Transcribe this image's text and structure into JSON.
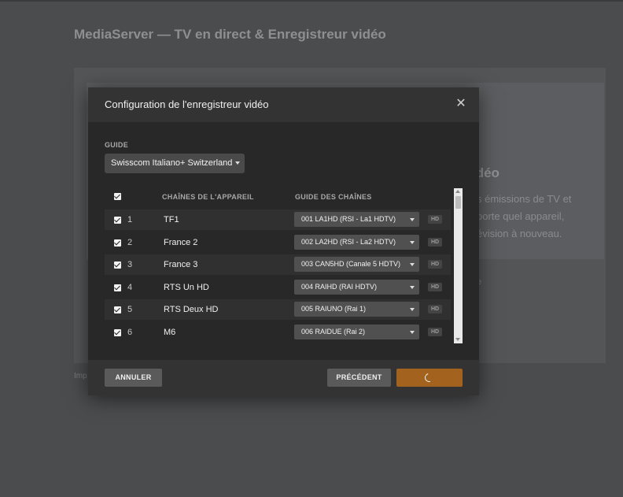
{
  "background": {
    "title": "MediaServer — TV en direct & Enregistreur vidéo",
    "card_title": "idéo",
    "card_lines": [
      "s émissions de TV et",
      "porte quel appareil,",
      "évision à nouveau."
    ],
    "link_fragment": "e",
    "footer_fragment": "Imp"
  },
  "modal": {
    "title": "Configuration de l'enregistreur vidéo",
    "close_icon": "close-icon",
    "guide_label": "GUIDE",
    "guide_value": "Swisscom Italiano+ Switzerland",
    "columns": {
      "device_channels": "CHAÎNES DE L'APPAREIL",
      "channel_guide": "GUIDE DES CHAÎNES"
    },
    "rows": [
      {
        "num": "1",
        "name": "TF1",
        "guide": "001 LA1HD (RSI - La1 HDTV)",
        "badge": "HD"
      },
      {
        "num": "2",
        "name": "France 2",
        "guide": "002 LA2HD (RSI - La2 HDTV)",
        "badge": "HD"
      },
      {
        "num": "3",
        "name": "France 3",
        "guide": "003 CAN5HD (Canale 5 HDTV)",
        "badge": "HD"
      },
      {
        "num": "4",
        "name": "RTS Un HD",
        "guide": "004 RAIHD (RAI HDTV)",
        "badge": "HD"
      },
      {
        "num": "5",
        "name": "RTS Deux HD",
        "guide": "005 RAIUNO (Rai 1)",
        "badge": "HD"
      },
      {
        "num": "6",
        "name": "M6",
        "guide": "006 RAIDUE (Rai 2)",
        "badge": "HD"
      }
    ],
    "buttons": {
      "cancel": "ANNULER",
      "previous": "PRÉCÉDENT"
    },
    "colors": {
      "accent": "#a3621d",
      "modal_bg": "#282828",
      "header_bg": "#333333"
    }
  }
}
